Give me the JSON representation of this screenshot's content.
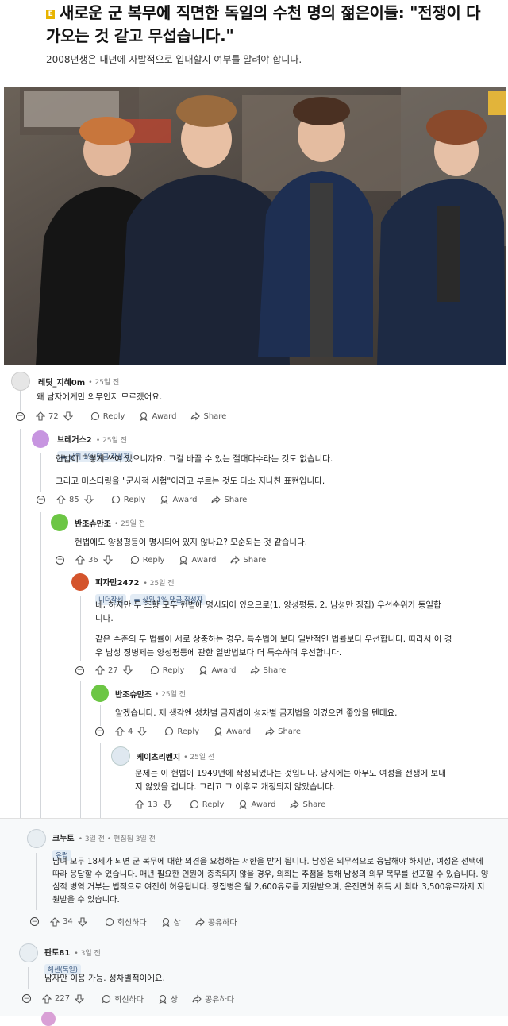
{
  "article": {
    "badge": "E",
    "headline": "새로운 군 복무에 직면한 독일의 수천 명의 젊은이들: \"전쟁이 다가오는 것 같고 무섭습니다.\"",
    "subtitle": "2008년생은 내년에 자발적으로 입대할지 여부를 알려야 합니다."
  },
  "comments": [
    {
      "user": "레딧_지혜0m",
      "time": "25일 전",
      "text": "왜 남자에게만 의무인지 모르겠어요.",
      "votes": "72",
      "reply": "Reply",
      "award": "Award",
      "share": "Share"
    },
    {
      "user": "브레거스2",
      "time": "25일 전",
      "flair": "상위 1% 댓글 작성자",
      "text1": "헌법이 그렇게 쓰여 있으니까요. 그걸 바꿀 수 있는 절대다수라는 것도 없습니다.",
      "text2": "그리고 머스터링을 \"군사적 시험\"이라고 부르는 것도 다소 지나친 표현입니다.",
      "votes": "85",
      "reply": "Reply",
      "award": "Award",
      "share": "Share"
    },
    {
      "user": "반조슈만조",
      "time": "25일 전",
      "text": "헌법에도 양성평등이 명시되어 있지 않나요? 모순되는 것 같습니다.",
      "votes": "36",
      "reply": "Reply",
      "award": "Award",
      "share": "Share"
    },
    {
      "user": "피자만2472",
      "time": "25일 전",
      "flair1": "니더작센",
      "flair2": "상위 1% 댓글 작성자",
      "text1": "네, 하지만 두 조항 모두 헌법에 명시되어 있으므로(1. 양성평등, 2. 남성만 징집) 우선순위가 동일합니다.",
      "text2": "같은 수준의 두 법률이 서로 상충하는 경우, 특수법이 보다 일반적인 법률보다 우선합니다. 따라서 이 경우 남성 징병제는 양성평등에 관한 일반법보다 더 특수하며 우선합니다.",
      "votes": "27",
      "reply": "Reply",
      "award": "Award",
      "share": "Share"
    },
    {
      "user": "반조슈만조",
      "time": "25일 전",
      "text": "알겠습니다. 제 생각엔 성차별 금지법이 성차별 금지법을 이겼으면 좋았을 텐데요.",
      "votes": "4",
      "reply": "Reply",
      "award": "Award",
      "share": "Share"
    },
    {
      "user": "케이츠리벤지",
      "time": "25일 전",
      "text": "문제는 이 헌법이 1949년에 작성되었다는 것입니다. 당시에는 아무도 여성을 전쟁에 보내지 않았을 겁니다. 그리고 그 이후로 개정되지 않았습니다.",
      "votes": "13",
      "reply": "Reply",
      "award": "Award",
      "share": "Share"
    },
    {
      "user": "크누토",
      "time": "3일 전",
      "edited": "편집됨 3일 전",
      "flair": "유럽",
      "text": "남녀 모두 18세가 되면 군 복무에 대한 의견을 요청하는 서한을 받게 됩니다. 남성은 의무적으로 응답해야 하지만, 여성은 선택에 따라 응답할 수 있습니다. 매년 필요한 인원이 충족되지 않을 경우, 의회는 추첨을 통해 남성의 의무 복무를 선포할 수 있습니다. 양심적 병역 거부는 법적으로 여전히 허용됩니다. 징집병은 월 2,600유로를 지원받으며, 운전면허 취득 시 최대 3,500유로까지 지원받을 수 있습니다.",
      "votes": "34",
      "reply": "회신하다",
      "award": "상",
      "share": "공유하다"
    },
    {
      "user": "판토81",
      "time": "3일 전",
      "flair": "헤센(독일)",
      "text": "남자만 이용 가능. 성차별적이에요.",
      "votes": "227",
      "reply": "회신하다",
      "award": "상",
      "share": "공유하다"
    }
  ]
}
